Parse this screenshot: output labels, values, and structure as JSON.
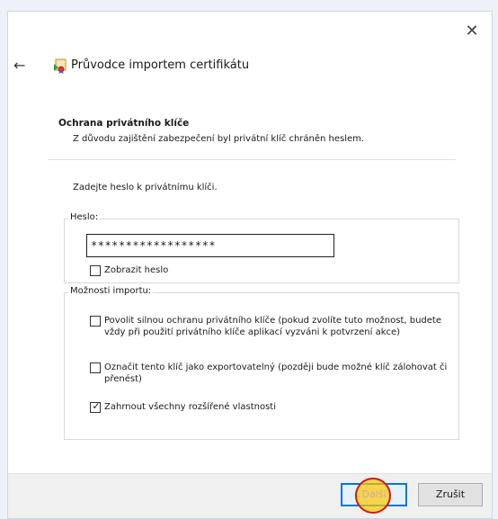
{
  "window": {
    "close_glyph": "✕",
    "back_glyph": "←",
    "title": "Průvodce importem certifikátu"
  },
  "section": {
    "heading": "Ochrana privátního klíče",
    "description": "Z důvodu zajištění zabezpečení byl privátní klíč chráněn heslem."
  },
  "prompt": "Zadejte heslo k privátnímu klíči.",
  "password_group": {
    "label": "Heslo:",
    "value": "******************",
    "show_password": {
      "label": "Zobrazit heslo",
      "checked": false
    }
  },
  "import_options": {
    "label": "Možnosti importu:",
    "items": [
      {
        "label": "Povolit silnou ochranu privátního klíče (pokud zvolíte tuto možnost, budete vždy při použití privátního klíče aplikací vyzváni k potvrzení akce)",
        "checked": false
      },
      {
        "label": "Označit tento klíč jako exportovatelný (později bude možné klíč zálohovat či přenést)",
        "checked": false
      },
      {
        "label": "Zahrnout všechny rozšířené vlastnosti",
        "checked": true
      }
    ]
  },
  "footer": {
    "next_label": "Další",
    "cancel_label": "Zrušit"
  },
  "colors": {
    "accent": "#0078d7",
    "click_marker_fill": "#ffc800",
    "click_marker_border": "#cc1a1a"
  },
  "icons": {
    "back": "arrow-left-icon",
    "wizard": "certificate-wizard-icon",
    "close": "close-icon"
  }
}
